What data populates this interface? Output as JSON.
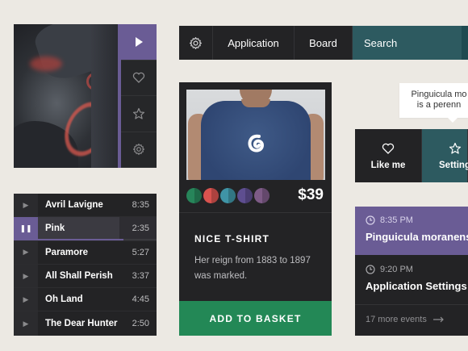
{
  "media": {
    "side_icons": [
      "play-icon",
      "heart-icon",
      "star-icon",
      "gear-icon"
    ]
  },
  "playlist": {
    "tracks": [
      {
        "name": "Avril Lavigne",
        "duration": "8:35",
        "state": "play"
      },
      {
        "name": "Pink",
        "duration": "2:35",
        "state": "pause"
      },
      {
        "name": "Paramore",
        "duration": "5:27",
        "state": "play"
      },
      {
        "name": "All Shall Perish",
        "duration": "3:37",
        "state": "play"
      },
      {
        "name": "Oh Land",
        "duration": "4:45",
        "state": "play"
      },
      {
        "name": "The Dear Hunter",
        "duration": "2:50",
        "state": "play"
      }
    ],
    "progress": 0.72
  },
  "navbar": {
    "items": [
      "Application",
      "Board",
      "Search"
    ],
    "active": "Search"
  },
  "product": {
    "colors": [
      "#27855a",
      "#d9534f",
      "#3f94a6",
      "#5e4e90",
      "#7e5b87"
    ],
    "price": "$39",
    "title": "NICE T-SHIRT",
    "description": "Her reign from 1883 to 1897 was marked.",
    "cta": "ADD TO BASKET"
  },
  "tooltip": {
    "line1": "Pinguicula mo",
    "line2": "is a perenn"
  },
  "actions": {
    "like": "Like me",
    "settings": "Setting"
  },
  "events": {
    "items": [
      {
        "time": "8:35 PM",
        "title": "Pinguicula moranens"
      },
      {
        "time": "9:20 PM",
        "title": "Application Settings"
      }
    ],
    "more": "17 more events"
  },
  "colors": {
    "purple": "#6a5c95",
    "teal": "#2d5a60",
    "green": "#238856",
    "dark": "#232325"
  }
}
